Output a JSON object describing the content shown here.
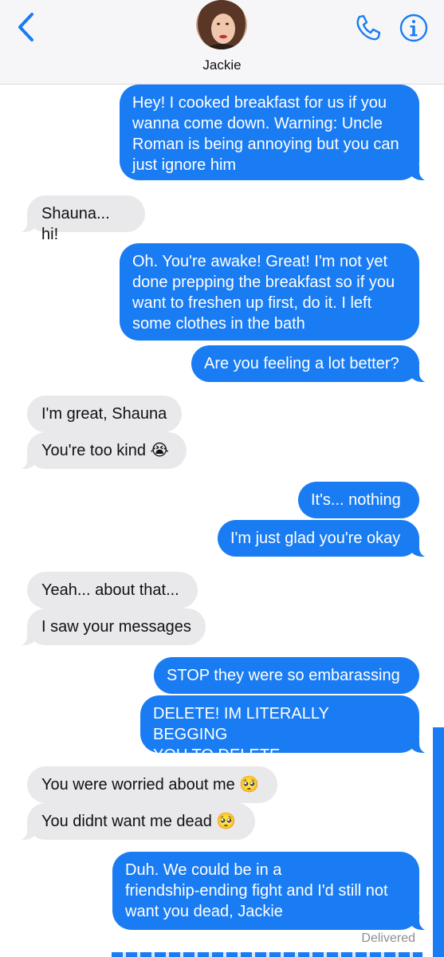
{
  "header": {
    "contact_name": "Jackie",
    "back_icon": "chevron-left-icon",
    "call_icon": "phone-icon",
    "info_icon": "info-icon",
    "accent": "#1a7cf3"
  },
  "messages": [
    {
      "from": "me",
      "text": "Hey! I cooked breakfast for us if you\nwanna come down. Warning: Uncle\nRoman is being annoying but you can\njust ignore him"
    },
    {
      "from": "them",
      "text": "Shauna... hi!"
    },
    {
      "from": "me",
      "text": "Oh. You're awake! Great! I'm not yet\ndone prepping the breakfast so if you\nwant to freshen up first, do it. I left\nsome clothes in the bath"
    },
    {
      "from": "me",
      "text": "Are you feeling a lot better?"
    },
    {
      "from": "them",
      "text": "I'm great, Shauna"
    },
    {
      "from": "them",
      "text": "You're too kind 😭"
    },
    {
      "from": "me",
      "text": "It's... nothing"
    },
    {
      "from": "me",
      "text": "I'm just glad you're okay"
    },
    {
      "from": "them",
      "text": "Yeah... about that..."
    },
    {
      "from": "them",
      "text": "I saw your messages"
    },
    {
      "from": "me",
      "text": "STOP they were so embarassing"
    },
    {
      "from": "me",
      "text": "DELETE! IM LITERALLY BEGGING\nYOU TO DELETE"
    },
    {
      "from": "them",
      "text": "You were worried about me 🥺"
    },
    {
      "from": "them",
      "text": "You didnt want me dead 🥺"
    },
    {
      "from": "me",
      "text": "Duh. We could be in a\nfriendship-ending fight and I'd still not\nwant you dead, Jackie"
    }
  ],
  "status": "Delivered",
  "colors": {
    "sent_bubble": "#1a7cf3",
    "received_bubble": "#e9e9eb",
    "header_bg": "#f6f6f8"
  }
}
